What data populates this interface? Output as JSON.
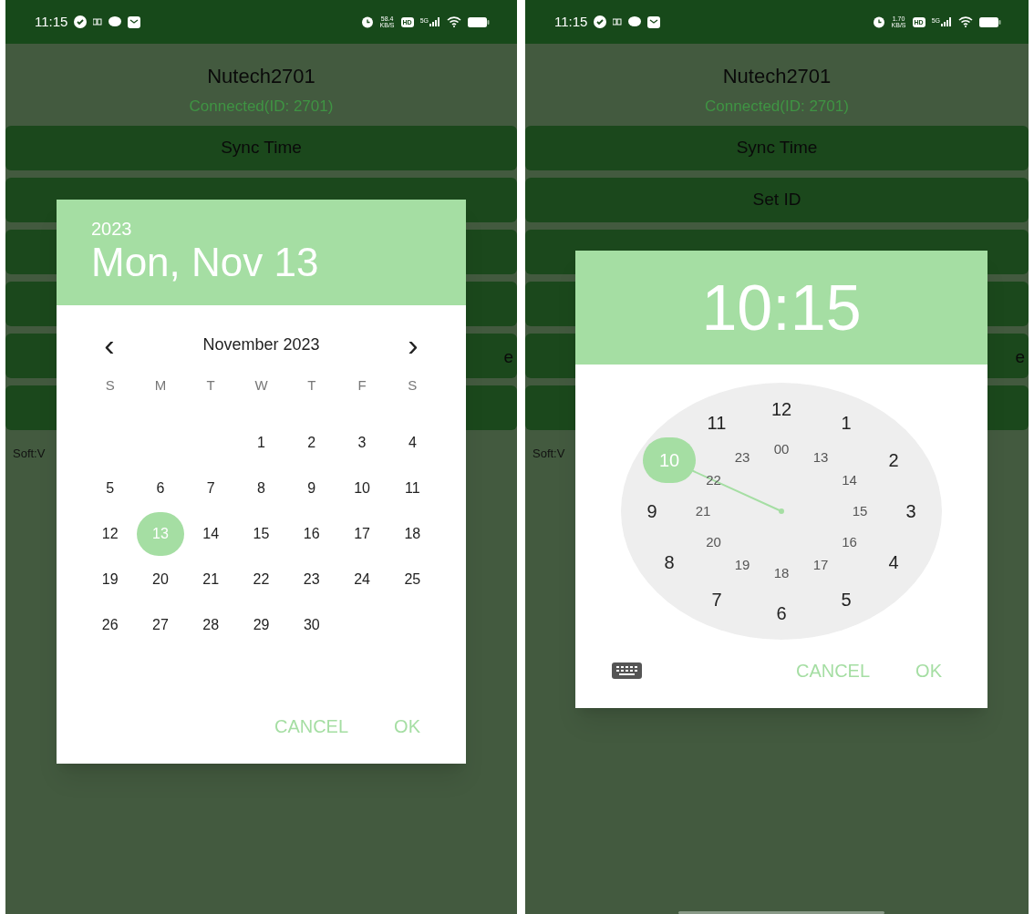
{
  "screens": [
    {
      "status_bar": {
        "time": "11:15",
        "net_speed": [
          "58.4",
          "KB/S"
        ],
        "network": "5G",
        "hd": "HD"
      },
      "app": {
        "title": "Nutech2701",
        "status": "Connected(ID: 2701)",
        "buttons": [
          {
            "kind": "text",
            "label": "Sync Time"
          },
          {
            "kind": "blank"
          },
          {
            "kind": "blank"
          },
          {
            "kind": "blank"
          },
          {
            "kind": "tail",
            "label": "e"
          },
          {
            "kind": "blank"
          }
        ],
        "footer": "Soft:V"
      },
      "dialog": {
        "kind": "date",
        "year": "2023",
        "date": "Mon, Nov 13",
        "month": "November 2023",
        "prev": "‹",
        "next": "›",
        "weekdays": [
          "S",
          "M",
          "T",
          "W",
          "T",
          "F",
          "S"
        ],
        "weeks": [
          [
            {
              "day": "1",
              "selected": false
            },
            {
              "day": "2",
              "selected": false
            },
            {
              "day": "3",
              "selected": false
            },
            {
              "day": "4",
              "selected": false
            }
          ],
          [
            {
              "day": "5",
              "selected": false
            },
            {
              "day": "6",
              "selected": false
            },
            {
              "day": "7",
              "selected": false
            },
            {
              "day": "8",
              "selected": false
            },
            {
              "day": "9",
              "selected": false
            },
            {
              "day": "10",
              "selected": false
            },
            {
              "day": "11",
              "selected": false
            }
          ],
          [
            {
              "day": "12",
              "selected": false
            },
            {
              "day": "13",
              "selected": true
            },
            {
              "day": "14",
              "selected": false
            },
            {
              "day": "15",
              "selected": false
            },
            {
              "day": "16",
              "selected": false
            },
            {
              "day": "17",
              "selected": false
            },
            {
              "day": "18",
              "selected": false
            }
          ],
          [
            {
              "day": "19",
              "selected": false
            },
            {
              "day": "20",
              "selected": false
            },
            {
              "day": "21",
              "selected": false
            },
            {
              "day": "22",
              "selected": false
            },
            {
              "day": "23",
              "selected": false
            },
            {
              "day": "24",
              "selected": false
            },
            {
              "day": "25",
              "selected": false
            }
          ],
          [
            {
              "day": "26",
              "selected": false
            },
            {
              "day": "27",
              "selected": false
            },
            {
              "day": "28",
              "selected": false
            },
            {
              "day": "29",
              "selected": false
            },
            {
              "day": "30",
              "selected": false
            }
          ]
        ],
        "actions": [
          "CANCEL",
          "OK"
        ]
      }
    },
    {
      "status_bar": {
        "time": "11:15",
        "net_speed": [
          "1.70",
          "KB/S"
        ],
        "network": "5G",
        "hd": "HD"
      },
      "app": {
        "title": "Nutech2701",
        "status": "Connected(ID: 2701)",
        "buttons": [
          {
            "kind": "text",
            "label": "Sync Time"
          },
          {
            "kind": "text",
            "label": "Set ID"
          },
          {
            "kind": "blank"
          },
          {
            "kind": "blank"
          },
          {
            "kind": "tail",
            "label": "e"
          },
          {
            "kind": "blank"
          }
        ],
        "footer": "Soft:V"
      },
      "dialog": {
        "kind": "time",
        "time": "10:15",
        "hours": [
          {
            "label": "12",
            "selected": false
          },
          {
            "label": "1",
            "selected": false
          },
          {
            "label": "2",
            "selected": false
          },
          {
            "label": "3",
            "selected": false
          },
          {
            "label": "4",
            "selected": false
          },
          {
            "label": "5",
            "selected": false
          },
          {
            "label": "6",
            "selected": false
          },
          {
            "label": "7",
            "selected": false
          },
          {
            "label": "8",
            "selected": false
          },
          {
            "label": "9",
            "selected": false
          },
          {
            "label": "10",
            "selected": true
          },
          {
            "label": "11",
            "selected": false
          }
        ],
        "inner_hours": [
          {
            "label": "00",
            "selected": false
          },
          {
            "label": "13",
            "selected": false
          },
          {
            "label": "14",
            "selected": false
          },
          {
            "label": "15",
            "selected": false
          },
          {
            "label": "16",
            "selected": false
          },
          {
            "label": "17",
            "selected": false
          },
          {
            "label": "18",
            "selected": false
          },
          {
            "label": "19",
            "selected": false
          },
          {
            "label": "20",
            "selected": false
          },
          {
            "label": "21",
            "selected": false
          },
          {
            "label": "22",
            "selected": false
          },
          {
            "label": "23",
            "selected": false
          }
        ],
        "actions": [
          "CANCEL",
          "OK"
        ]
      }
    }
  ]
}
